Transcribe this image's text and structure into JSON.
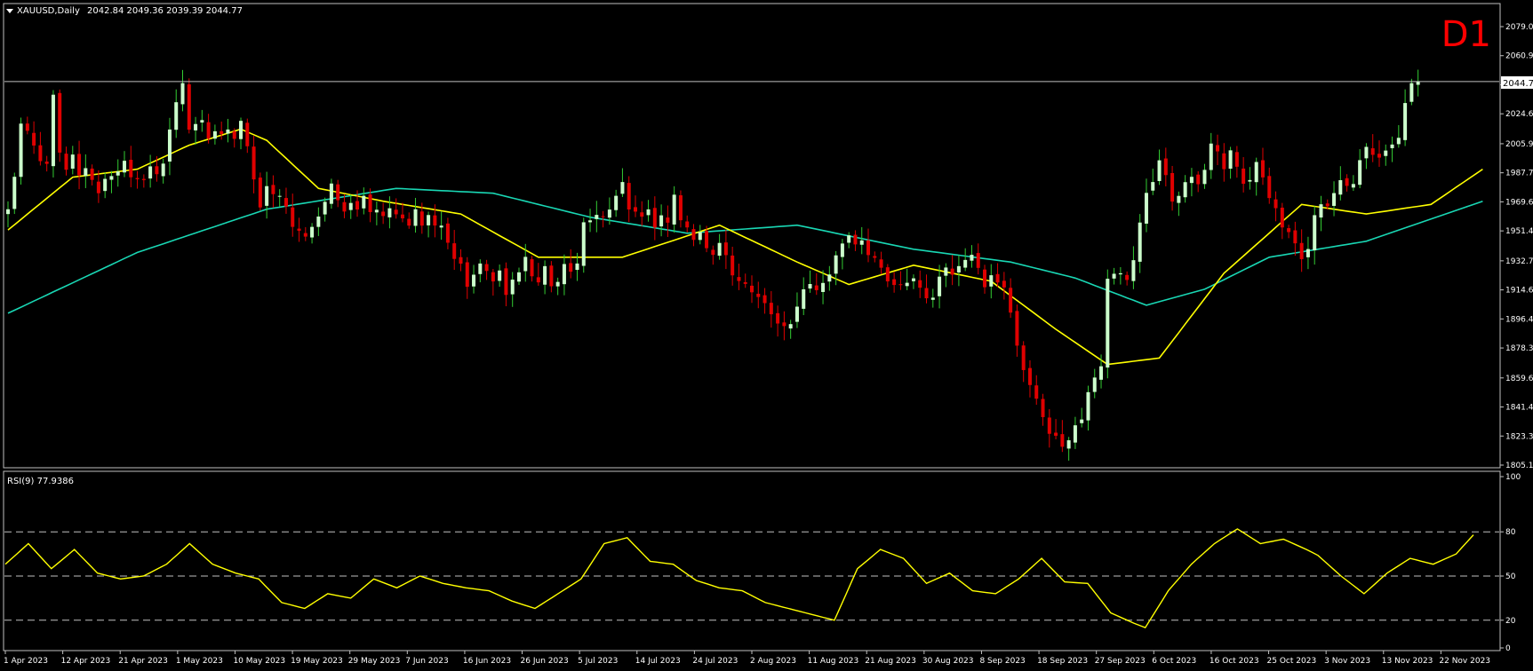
{
  "header": {
    "symbol_label": "XAUUSD,Daily",
    "ohlc": "2042.84 2049.36 2039.39 2044.77",
    "timeframe_badge": "D1"
  },
  "rsi_label": "RSI(9) 77.9386",
  "price_tag": "2044.77",
  "colors": {
    "background": "#000000",
    "frame": "#c0c0c0",
    "bull": "#ccffcc",
    "bear": "#e00000",
    "wick_bull": "#33cc33",
    "ma_fast": "#ffff00",
    "ma_slow": "#19d7b4",
    "rsi": "#ffff00",
    "badge": "#ff0000"
  },
  "chart_data": [
    {
      "type": "candlestick",
      "title": "XAUUSD,Daily",
      "ylim": [
        1805.15,
        2079.05
      ],
      "y_ticks": [
        "2079.05",
        "2060.90",
        "2042.75",
        "2024.60",
        "2005.90",
        "1987.75",
        "1969.60",
        "1951.45",
        "1932.75",
        "1914.60",
        "1896.45",
        "1878.30",
        "1859.60",
        "1841.45",
        "1823.30",
        "1805.15"
      ],
      "x_ticks": [
        "1 Apr 2023",
        "12 Apr 2023",
        "21 Apr 2023",
        "1 May 2023",
        "10 May 2023",
        "19 May 2023",
        "29 May 2023",
        "7 Jun 2023",
        "16 Jun 2023",
        "26 Jun 2023",
        "5 Jul 2023",
        "14 Jul 2023",
        "24 Jul 2023",
        "2 Aug 2023",
        "11 Aug 2023",
        "21 Aug 2023",
        "30 Aug 2023",
        "8 Sep 2023",
        "18 Sep 2023",
        "27 Sep 2023",
        "6 Oct 2023",
        "16 Oct 2023",
        "25 Oct 2023",
        "3 Nov 2023",
        "13 Nov 2023",
        "22 Nov 2023"
      ],
      "last_price": 2044.77,
      "close_anchors": [
        [
          0,
          1965
        ],
        [
          1,
          1985
        ],
        [
          2,
          2020
        ],
        [
          3,
          2015
        ],
        [
          4,
          2005
        ],
        [
          5,
          1995
        ],
        [
          6,
          1995
        ],
        [
          7,
          2035
        ],
        [
          8,
          2000
        ],
        [
          9,
          1990
        ],
        [
          10,
          2000
        ],
        [
          11,
          1985
        ],
        [
          12,
          1990
        ],
        [
          13,
          1985
        ],
        [
          14,
          1975
        ],
        [
          15,
          1985
        ],
        [
          16,
          1985
        ],
        [
          17,
          1990
        ],
        [
          18,
          1995
        ],
        [
          19,
          1985
        ],
        [
          20,
          1985
        ],
        [
          21,
          1985
        ],
        [
          22,
          1990
        ],
        [
          23,
          1985
        ],
        [
          24,
          1995
        ],
        [
          25,
          2015
        ],
        [
          26,
          2030
        ],
        [
          27,
          2045
        ],
        [
          28,
          2015
        ],
        [
          29,
          2018
        ],
        [
          30,
          2020
        ],
        [
          31,
          2010
        ],
        [
          32,
          2015
        ],
        [
          33,
          2010
        ],
        [
          34,
          2015
        ],
        [
          35,
          2010
        ],
        [
          36,
          2020
        ],
        [
          37,
          2005
        ],
        [
          38,
          1985
        ],
        [
          39,
          1965
        ],
        [
          40,
          1980
        ],
        [
          41,
          1975
        ],
        [
          42,
          1975
        ],
        [
          43,
          1965
        ],
        [
          44,
          1955
        ],
        [
          45,
          1950
        ],
        [
          46,
          1948
        ],
        [
          47,
          1955
        ],
        [
          48,
          1960
        ],
        [
          49,
          1970
        ],
        [
          50,
          1980
        ],
        [
          51,
          1970
        ],
        [
          52,
          1965
        ],
        [
          53,
          1970
        ],
        [
          54,
          1965
        ],
        [
          55,
          1975
        ],
        [
          56,
          1965
        ],
        [
          57,
          1965
        ],
        [
          58,
          1960
        ],
        [
          59,
          1965
        ],
        [
          60,
          1960
        ],
        [
          61,
          1960
        ],
        [
          62,
          1955
        ],
        [
          63,
          1965
        ],
        [
          64,
          1955
        ],
        [
          65,
          1960
        ],
        [
          66,
          1955
        ],
        [
          67,
          1955
        ],
        [
          68,
          1945
        ],
        [
          69,
          1935
        ],
        [
          70,
          1930
        ],
        [
          71,
          1918
        ],
        [
          72,
          1925
        ],
        [
          73,
          1930
        ],
        [
          74,
          1925
        ],
        [
          75,
          1918
        ],
        [
          76,
          1925
        ],
        [
          77,
          1910
        ],
        [
          78,
          1920
        ],
        [
          79,
          1925
        ],
        [
          80,
          1935
        ],
        [
          81,
          1925
        ],
        [
          82,
          1920
        ],
        [
          83,
          1930
        ],
        [
          84,
          1918
        ],
        [
          85,
          1920
        ],
        [
          86,
          1930
        ],
        [
          87,
          1925
        ],
        [
          88,
          1932
        ],
        [
          89,
          1955
        ],
        [
          90,
          1960
        ],
        [
          91,
          1962
        ],
        [
          92,
          1960
        ],
        [
          93,
          1965
        ],
        [
          94,
          1975
        ],
        [
          95,
          1980
        ],
        [
          96,
          1965
        ],
        [
          97,
          1962
        ],
        [
          98,
          1960
        ],
        [
          99,
          1965
        ],
        [
          100,
          1955
        ],
        [
          101,
          1960
        ],
        [
          102,
          1955
        ],
        [
          103,
          1975
        ],
        [
          104,
          1960
        ],
        [
          105,
          1955
        ],
        [
          106,
          1945
        ],
        [
          107,
          1950
        ],
        [
          108,
          1940
        ],
        [
          109,
          1935
        ],
        [
          110,
          1945
        ],
        [
          111,
          1935
        ],
        [
          112,
          1925
        ],
        [
          113,
          1922
        ],
        [
          114,
          1920
        ],
        [
          115,
          1915
        ],
        [
          116,
          1910
        ],
        [
          117,
          1905
        ],
        [
          118,
          1898
        ],
        [
          119,
          1895
        ],
        [
          120,
          1892
        ],
        [
          121,
          1895
        ],
        [
          122,
          1905
        ],
        [
          123,
          1915
        ],
        [
          124,
          1920
        ],
        [
          125,
          1915
        ],
        [
          126,
          1920
        ],
        [
          127,
          1925
        ],
        [
          128,
          1935
        ],
        [
          129,
          1945
        ],
        [
          130,
          1950
        ],
        [
          131,
          1945
        ],
        [
          132,
          1945
        ],
        [
          133,
          1938
        ],
        [
          134,
          1935
        ],
        [
          135,
          1930
        ],
        [
          136,
          1920
        ],
        [
          137,
          1918
        ],
        [
          138,
          1920
        ],
        [
          139,
          1918
        ],
        [
          140,
          1922
        ],
        [
          141,
          1915
        ],
        [
          142,
          1910
        ],
        [
          143,
          1908
        ],
        [
          144,
          1922
        ],
        [
          145,
          1928
        ],
        [
          146,
          1925
        ],
        [
          147,
          1930
        ],
        [
          148,
          1935
        ],
        [
          149,
          1935
        ],
        [
          150,
          1930
        ],
        [
          151,
          1918
        ],
        [
          152,
          1925
        ],
        [
          153,
          1920
        ],
        [
          154,
          1918
        ],
        [
          155,
          1900
        ],
        [
          156,
          1880
        ],
        [
          157,
          1865
        ],
        [
          158,
          1855
        ],
        [
          159,
          1845
        ],
        [
          160,
          1835
        ],
        [
          161,
          1825
        ],
        [
          162,
          1825
        ],
        [
          163,
          1815
        ],
        [
          164,
          1820
        ],
        [
          165,
          1830
        ],
        [
          166,
          1832
        ],
        [
          167,
          1850
        ],
        [
          168,
          1860
        ],
        [
          169,
          1865
        ],
        [
          170,
          1920
        ],
        [
          171,
          1925
        ],
        [
          172,
          1925
        ],
        [
          173,
          1920
        ],
        [
          174,
          1932
        ],
        [
          175,
          1955
        ],
        [
          176,
          1975
        ],
        [
          177,
          1980
        ],
        [
          178,
          1995
        ],
        [
          179,
          1985
        ],
        [
          180,
          1970
        ],
        [
          181,
          1975
        ],
        [
          182,
          1980
        ],
        [
          183,
          1985
        ],
        [
          184,
          1980
        ],
        [
          185,
          1990
        ],
        [
          186,
          2005
        ],
        [
          187,
          2000
        ],
        [
          188,
          1990
        ],
        [
          189,
          2002
        ],
        [
          190,
          1990
        ],
        [
          191,
          1980
        ],
        [
          192,
          1985
        ],
        [
          193,
          1995
        ],
        [
          194,
          1985
        ],
        [
          195,
          1970
        ],
        [
          196,
          1965
        ],
        [
          197,
          1955
        ],
        [
          198,
          1950
        ],
        [
          199,
          1945
        ],
        [
          200,
          1935
        ],
        [
          201,
          1940
        ],
        [
          202,
          1962
        ],
        [
          203,
          1970
        ],
        [
          204,
          1965
        ],
        [
          205,
          1975
        ],
        [
          206,
          1985
        ],
        [
          207,
          1980
        ],
        [
          208,
          1982
        ],
        [
          209,
          1995
        ],
        [
          210,
          2005
        ],
        [
          211,
          1998
        ],
        [
          212,
          1998
        ],
        [
          213,
          2000
        ],
        [
          214,
          2005
        ],
        [
          215,
          2010
        ],
        [
          216,
          2030
        ],
        [
          217,
          2045
        ],
        [
          218,
          2044.77
        ]
      ],
      "ma_fast_anchors": [
        [
          0,
          1952
        ],
        [
          10,
          1985
        ],
        [
          20,
          1990
        ],
        [
          28,
          2005
        ],
        [
          36,
          2015
        ],
        [
          40,
          2008
        ],
        [
          48,
          1978
        ],
        [
          58,
          1970
        ],
        [
          70,
          1962
        ],
        [
          82,
          1935
        ],
        [
          95,
          1935
        ],
        [
          110,
          1955
        ],
        [
          122,
          1932
        ],
        [
          130,
          1918
        ],
        [
          140,
          1930
        ],
        [
          152,
          1920
        ],
        [
          162,
          1890
        ],
        [
          170,
          1868
        ],
        [
          178,
          1872
        ],
        [
          188,
          1925
        ],
        [
          200,
          1968
        ],
        [
          210,
          1962
        ],
        [
          220,
          1968
        ],
        [
          228,
          1990
        ]
      ],
      "ma_slow_anchors": [
        [
          0,
          1900
        ],
        [
          20,
          1938
        ],
        [
          40,
          1965
        ],
        [
          60,
          1978
        ],
        [
          75,
          1975
        ],
        [
          90,
          1960
        ],
        [
          105,
          1950
        ],
        [
          122,
          1955
        ],
        [
          140,
          1940
        ],
        [
          155,
          1932
        ],
        [
          165,
          1922
        ],
        [
          176,
          1905
        ],
        [
          185,
          1915
        ],
        [
          195,
          1935
        ],
        [
          210,
          1945
        ],
        [
          228,
          1970
        ]
      ]
    },
    {
      "type": "line",
      "title": "RSI(9) 77.9386",
      "ylim": [
        0,
        100
      ],
      "y_ticks": [
        "100",
        "80",
        "50",
        "20",
        "0"
      ],
      "levels": [
        80,
        50,
        20
      ],
      "rsi_anchors": [
        [
          0,
          58
        ],
        [
          4,
          72
        ],
        [
          8,
          55
        ],
        [
          12,
          68
        ],
        [
          16,
          52
        ],
        [
          20,
          48
        ],
        [
          24,
          50
        ],
        [
          28,
          58
        ],
        [
          32,
          72
        ],
        [
          36,
          58
        ],
        [
          40,
          52
        ],
        [
          44,
          48
        ],
        [
          48,
          32
        ],
        [
          52,
          28
        ],
        [
          56,
          38
        ],
        [
          60,
          35
        ],
        [
          64,
          48
        ],
        [
          68,
          42
        ],
        [
          72,
          50
        ],
        [
          76,
          45
        ],
        [
          80,
          42
        ],
        [
          84,
          40
        ],
        [
          88,
          33
        ],
        [
          92,
          28
        ],
        [
          96,
          38
        ],
        [
          100,
          48
        ],
        [
          104,
          72
        ],
        [
          108,
          76
        ],
        [
          112,
          60
        ],
        [
          116,
          58
        ],
        [
          120,
          47
        ],
        [
          124,
          42
        ],
        [
          128,
          40
        ],
        [
          132,
          32
        ],
        [
          136,
          28
        ],
        [
          140,
          24
        ],
        [
          144,
          20
        ],
        [
          148,
          55
        ],
        [
          152,
          68
        ],
        [
          156,
          62
        ],
        [
          160,
          45
        ],
        [
          164,
          52
        ],
        [
          168,
          40
        ],
        [
          172,
          38
        ],
        [
          176,
          48
        ],
        [
          180,
          62
        ],
        [
          184,
          46
        ],
        [
          188,
          45
        ],
        [
          192,
          25
        ],
        [
          196,
          18
        ],
        [
          198,
          15
        ],
        [
          202,
          40
        ],
        [
          206,
          58
        ],
        [
          210,
          72
        ],
        [
          214,
          82
        ],
        [
          218,
          72
        ],
        [
          222,
          75
        ],
        [
          226,
          68
        ],
        [
          228,
          64
        ],
        [
          232,
          50
        ],
        [
          236,
          38
        ],
        [
          240,
          52
        ],
        [
          244,
          62
        ],
        [
          248,
          58
        ],
        [
          252,
          65
        ],
        [
          255,
          77.94
        ]
      ]
    }
  ]
}
